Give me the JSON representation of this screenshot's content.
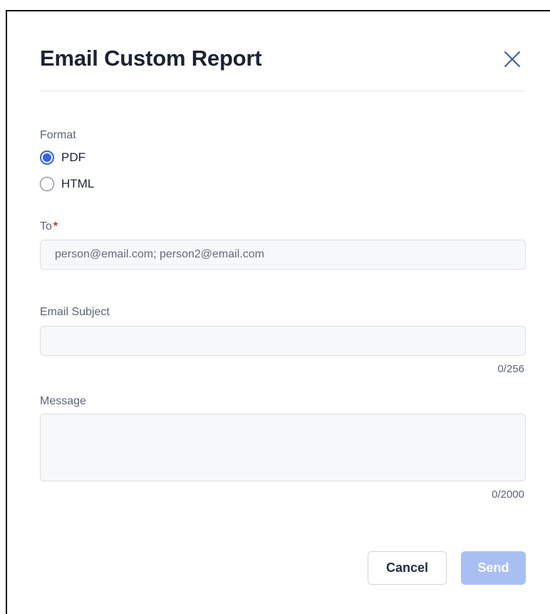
{
  "dialog": {
    "title": "Email Custom Report",
    "close_icon": "close-icon"
  },
  "format": {
    "label": "Format",
    "options": [
      {
        "label": "PDF",
        "checked": true
      },
      {
        "label": "HTML",
        "checked": false
      }
    ]
  },
  "to": {
    "label": "To",
    "required_marker": "*",
    "value": "",
    "placeholder": "person@email.com; person2@email.com"
  },
  "subject": {
    "label": "Email Subject",
    "value": "",
    "counter": "0/256"
  },
  "message": {
    "label": "Message",
    "value": "",
    "counter": "0/2000"
  },
  "actions": {
    "cancel_label": "Cancel",
    "send_label": "Send"
  },
  "colors": {
    "accent": "#3563e9",
    "send_disabled": "#a9bff4",
    "required": "#e02424",
    "title": "#1b2333"
  }
}
